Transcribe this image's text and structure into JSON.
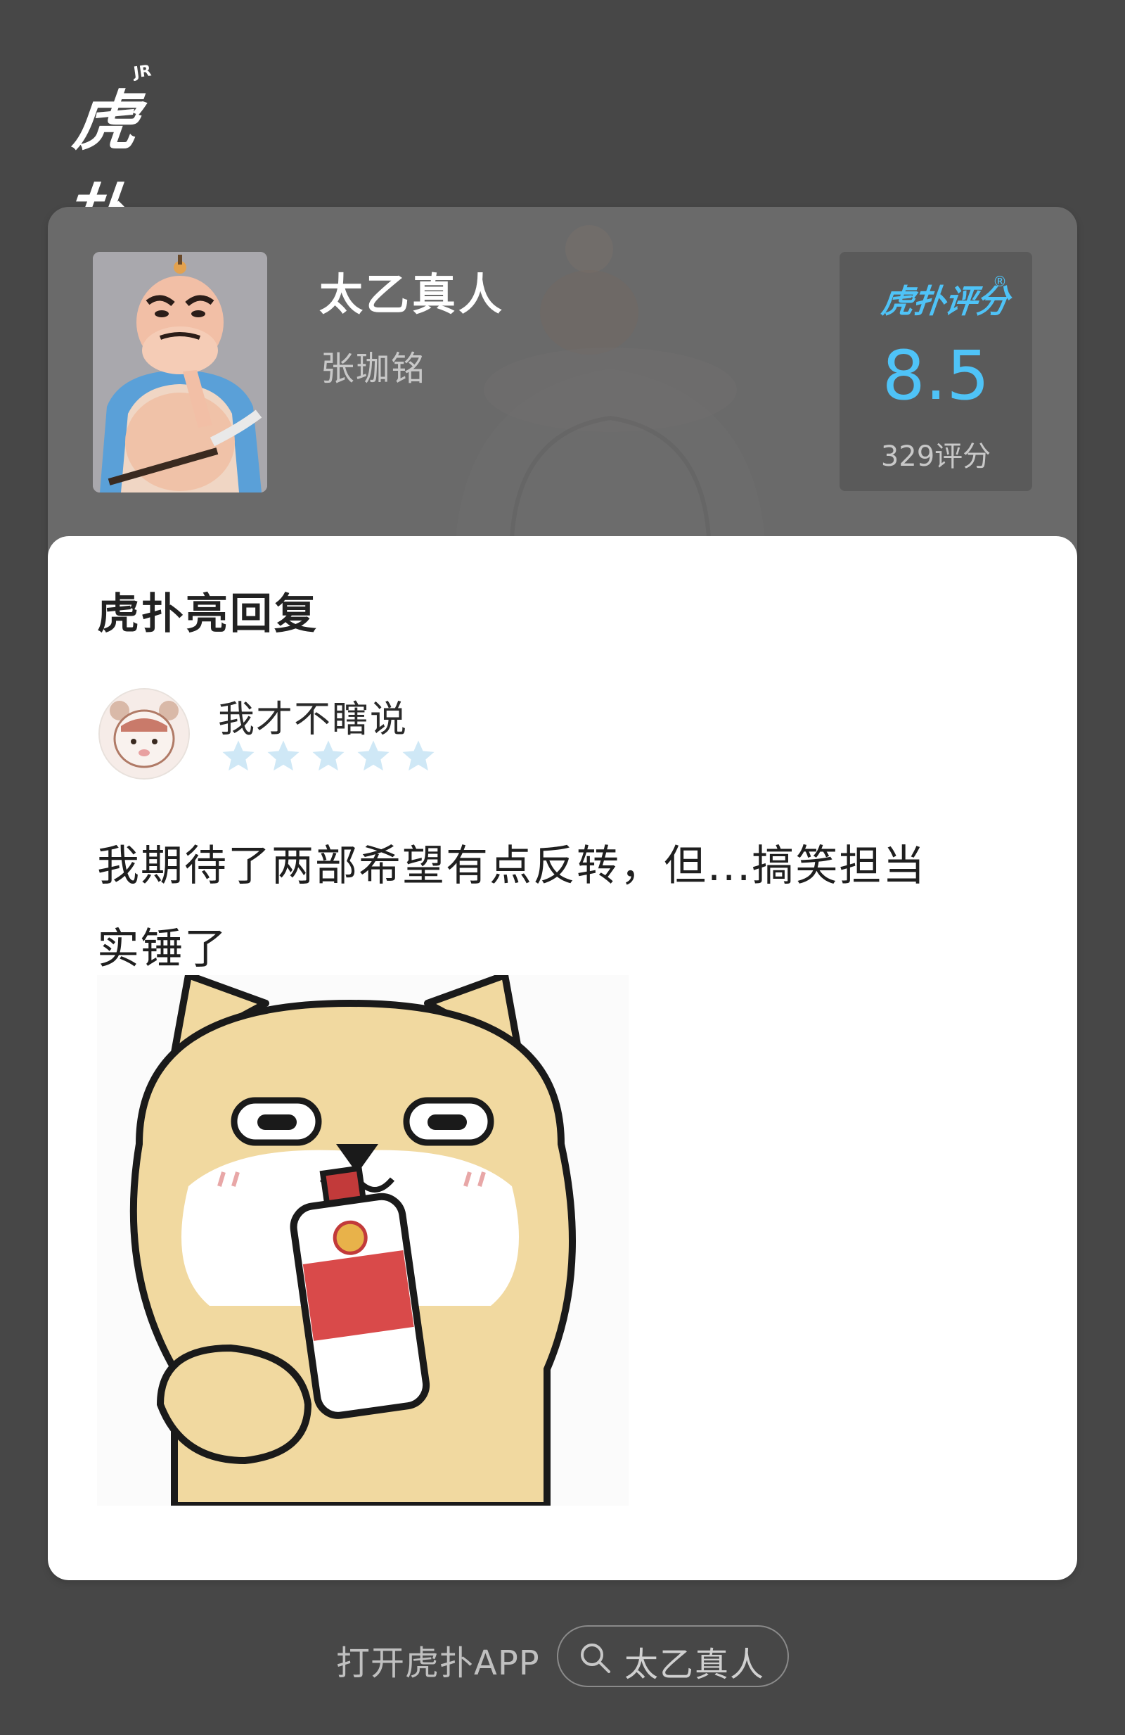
{
  "app": {
    "logo_text": "虎扑",
    "logo_badge": "JR"
  },
  "movie": {
    "title": "太乙真人",
    "cast": "张珈铭"
  },
  "score": {
    "logo_text": "虎扑评分",
    "logo_reg": "®",
    "value": "8.5",
    "count": "329评分"
  },
  "reply": {
    "section_title": "虎扑亮回复",
    "user_name": "我才不瞎说",
    "rating": 5,
    "comment_line1": "我期待了两部希望有点反转，但...搞笑担当",
    "comment_line2": "实锤了"
  },
  "footer": {
    "open_app": "打开虎扑APP",
    "search_text": "太乙真人"
  },
  "colors": {
    "accent": "#4fc3f7",
    "star": "#cfe8f6",
    "background": "#474747"
  },
  "icons": {
    "search": "search-icon",
    "star": "star-icon"
  }
}
